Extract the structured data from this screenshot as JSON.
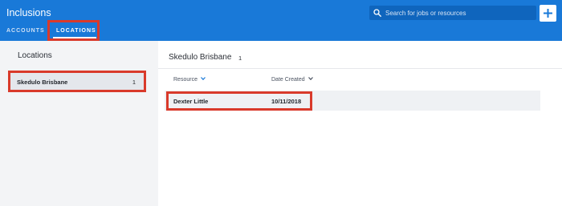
{
  "header": {
    "app_title": "Inclusions",
    "search": {
      "placeholder": "Search for jobs or resources",
      "icon": "search-icon"
    },
    "add_button": {
      "icon": "plus-icon"
    },
    "colors": {
      "background": "#1979d8",
      "search_background": "#0f65bd",
      "highlight": "#d93a2b"
    }
  },
  "tabs": [
    {
      "label": "ACCOUNTS",
      "active": false
    },
    {
      "label": "LOCATIONS",
      "active": true
    }
  ],
  "sidebar": {
    "title": "Locations",
    "items": [
      {
        "name": "Skedulo Brisbane",
        "count": "1",
        "selected": true
      }
    ]
  },
  "main": {
    "title": "Skedulo Brisbane",
    "count": "1",
    "columns": [
      {
        "label": "Resource",
        "icon": "chevron-down-icon",
        "icon_color": "#1979d8"
      },
      {
        "label": "Date Created",
        "icon": "chevron-down-icon",
        "icon_color": "#4a5260"
      }
    ],
    "rows": [
      {
        "resource": "Dexter Little",
        "date_created": "10/11/2018"
      }
    ]
  }
}
